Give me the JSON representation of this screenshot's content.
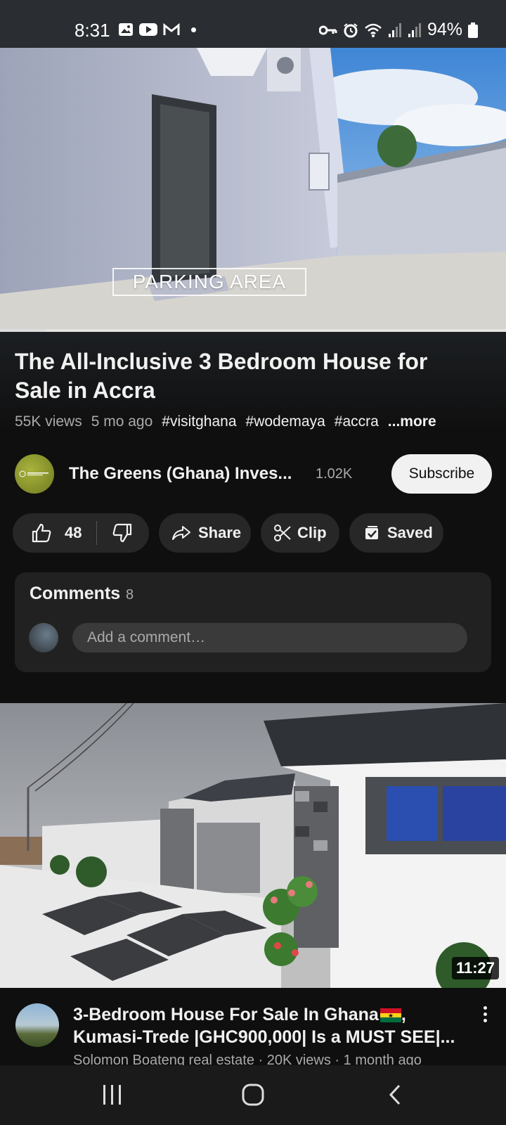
{
  "status_bar": {
    "time": "8:31",
    "battery": "94%",
    "left_icons": [
      "gallery-icon",
      "youtube-icon",
      "gmail-icon",
      "dot"
    ],
    "right_icons": [
      "vpn-key-icon",
      "alarm-icon",
      "wifi-icon",
      "signal-icon",
      "signal-icon",
      "battery-icon"
    ]
  },
  "player": {
    "overlay_text": "PARKING AREA",
    "progress": 0.09
  },
  "video": {
    "title": "The All-Inclusive 3 Bedroom House for Sale in Accra",
    "views": "55K views",
    "age": "5 mo ago",
    "hashtags": [
      "#visitghana",
      "#wodemaya",
      "#accra"
    ],
    "more_label": "...more"
  },
  "channel": {
    "name": "The Greens (Ghana) Inves...",
    "subscribers": "1.02K",
    "subscribe_label": "Subscribe",
    "avatar_text": "THE GREENS"
  },
  "actions": {
    "like_count": "48",
    "share_label": "Share",
    "clip_label": "Clip",
    "saved_label": "Saved"
  },
  "comments": {
    "title": "Comments",
    "count": "8",
    "placeholder": "Add a comment…"
  },
  "recommended": {
    "duration": "11:27",
    "title_line1": "3-Bedroom House For Sale In Ghana",
    "title_line1_suffix": ",",
    "title_line2": "Kumasi-Trede |GHC900,000| Is a MUST SEE|...",
    "meta": "Solomon Boateng real estate · 20K views · 1 month ago"
  },
  "nav": {
    "buttons": [
      "recents-icon",
      "home-icon",
      "back-icon"
    ]
  },
  "colors": {
    "background": "#0f0f0f",
    "pill": "#272727",
    "muted_text": "#aaa",
    "subscribe_bg": "#f1f1f1"
  }
}
